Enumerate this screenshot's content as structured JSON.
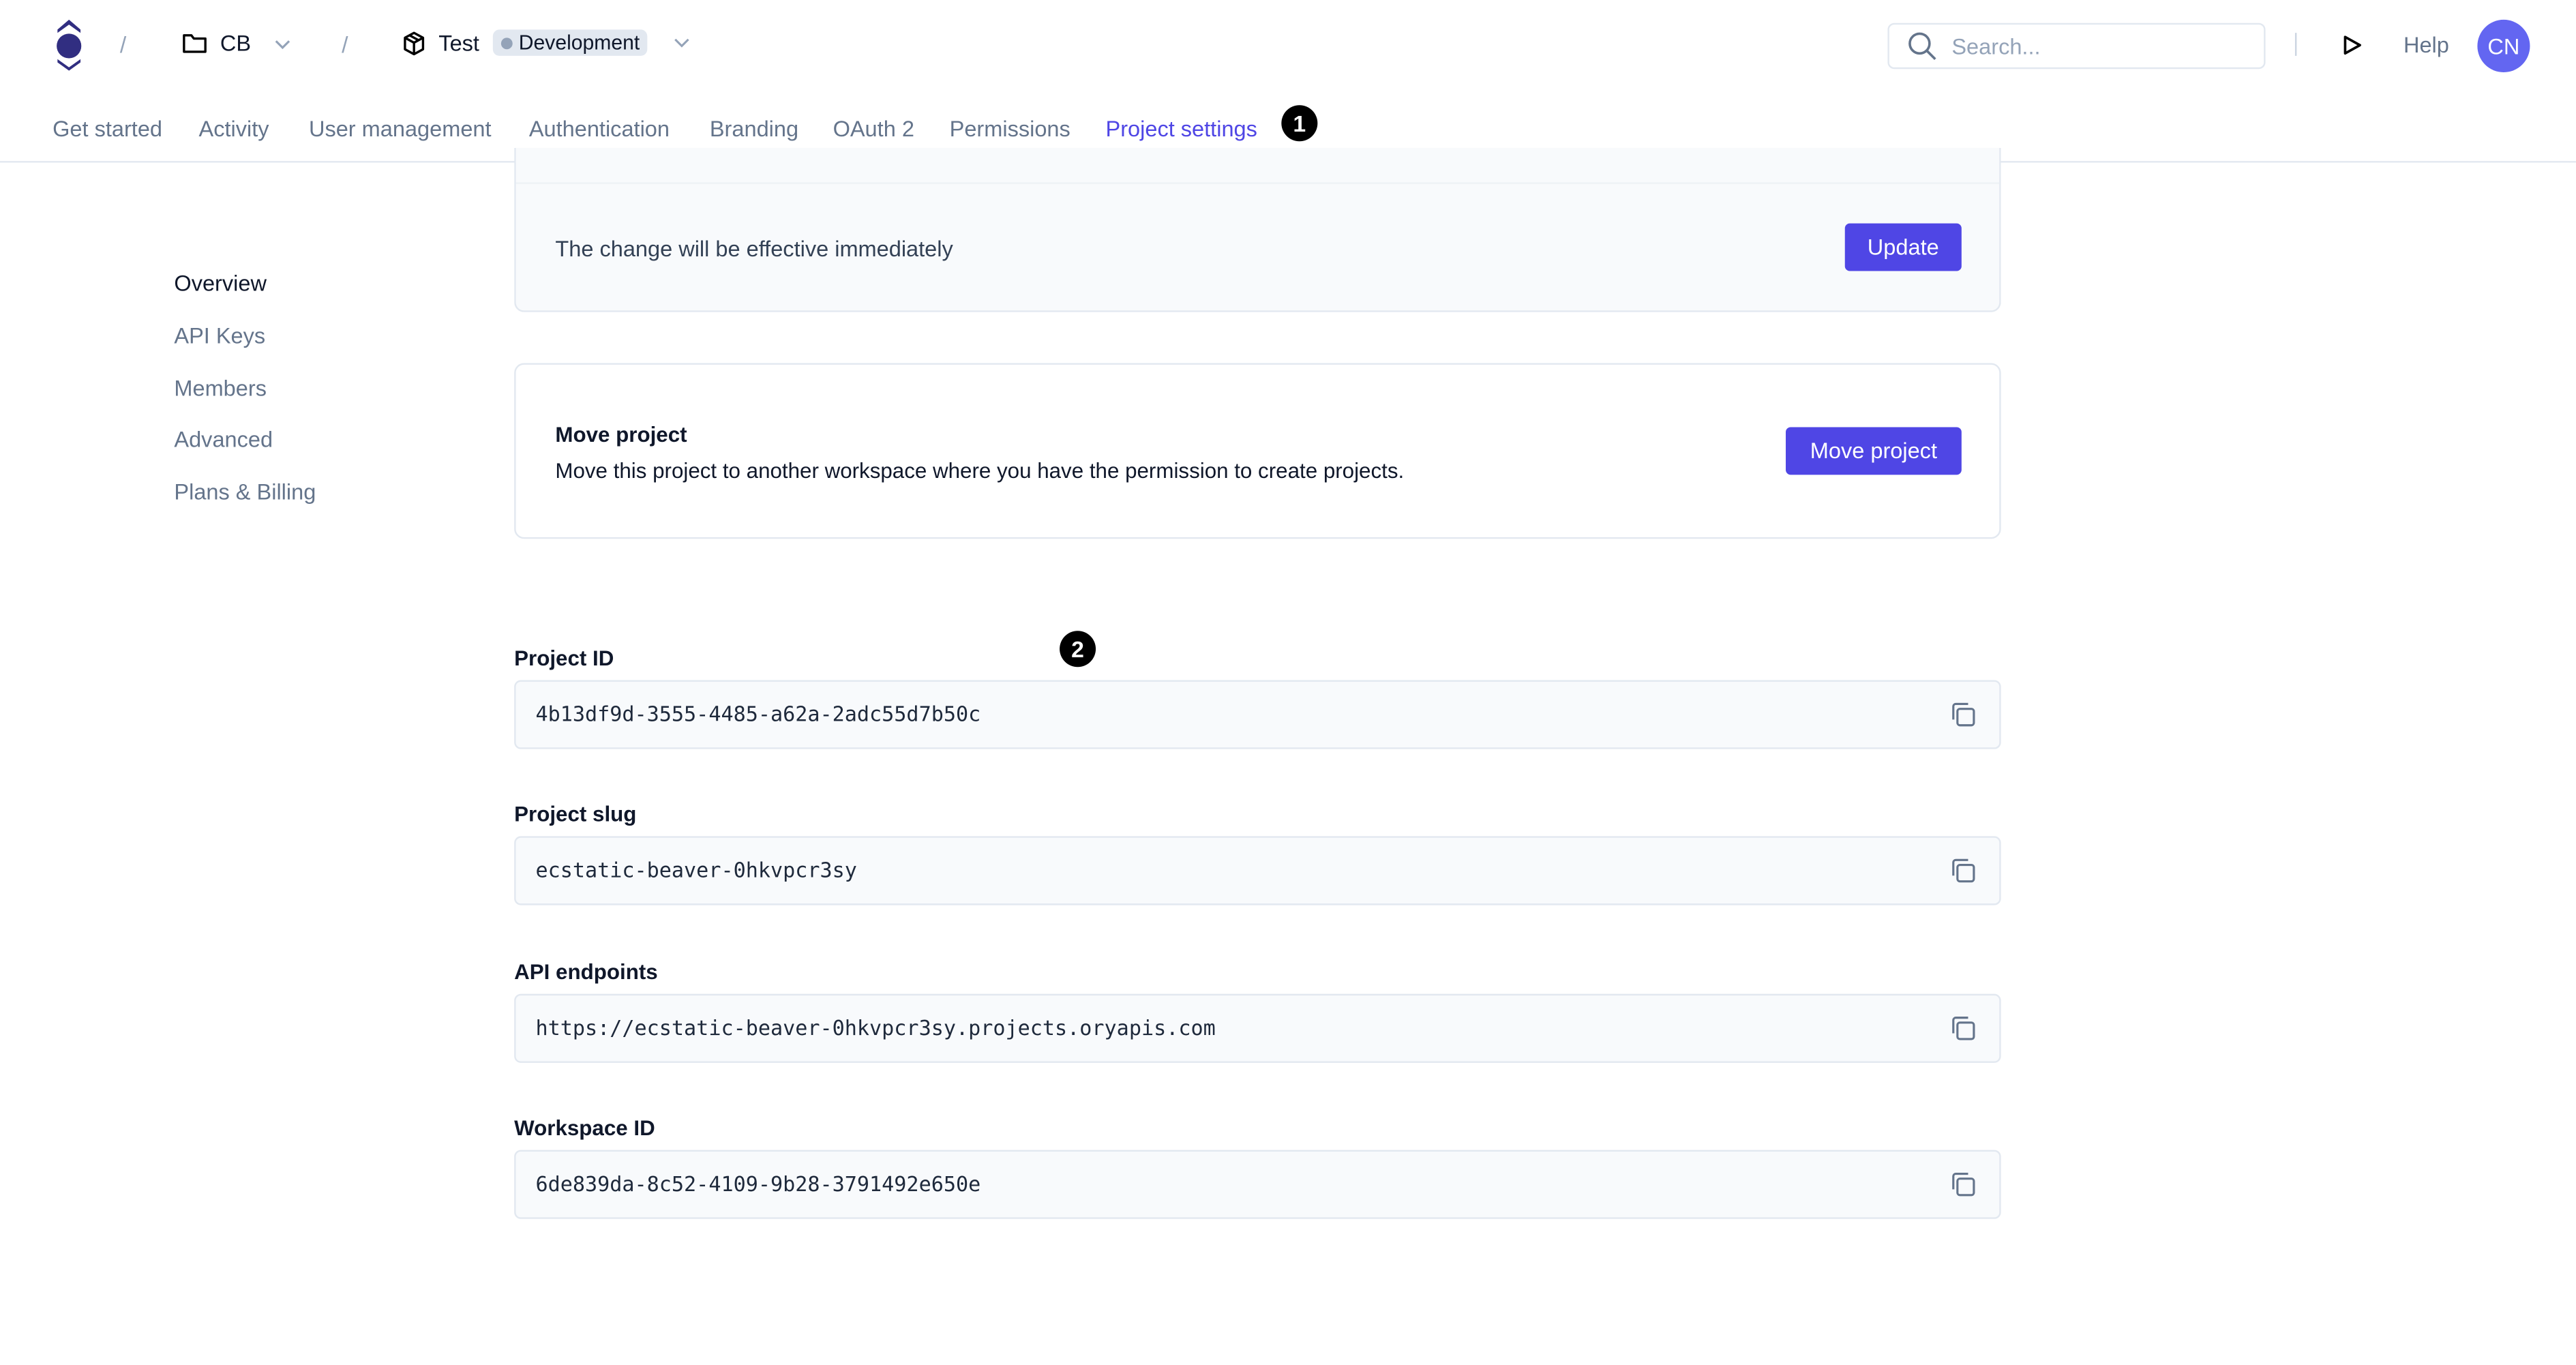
{
  "header": {
    "breadcrumb_sep": "/",
    "workspace": "CB",
    "project": "Test",
    "environment_badge": "Development",
    "search_placeholder": "Search...",
    "help": "Help",
    "avatar_initials": "CN",
    "brand_color": "#312e81",
    "accent_color": "#4f46e5",
    "avatar_color": "#6366f1"
  },
  "tabs": [
    {
      "label": "Get started"
    },
    {
      "label": "Activity"
    },
    {
      "label": "User management"
    },
    {
      "label": "Authentication"
    },
    {
      "label": "Branding"
    },
    {
      "label": "OAuth 2"
    },
    {
      "label": "Permissions"
    },
    {
      "label": "Project settings",
      "active": true
    }
  ],
  "annotations": [
    "1",
    "2"
  ],
  "sidebar": {
    "items": [
      {
        "label": "Overview",
        "active": true
      },
      {
        "label": "API Keys"
      },
      {
        "label": "Members"
      },
      {
        "label": "Advanced"
      },
      {
        "label": "Plans & Billing"
      }
    ]
  },
  "update_card": {
    "text": "The change will be effective immediately",
    "button": "Update"
  },
  "move_card": {
    "title": "Move project",
    "description": "Move this project to another workspace where you have the permission to create projects.",
    "button": "Move project"
  },
  "fields": [
    {
      "label": "Project ID",
      "value": "4b13df9d-3555-4485-a62a-2adc55d7b50c"
    },
    {
      "label": "Project slug",
      "value": "ecstatic-beaver-0hkvpcr3sy"
    },
    {
      "label": "API endpoints",
      "value": "https://ecstatic-beaver-0hkvpcr3sy.projects.oryapis.com"
    },
    {
      "label": "Workspace ID",
      "value": "6de839da-8c52-4109-9b28-3791492e650e"
    }
  ]
}
